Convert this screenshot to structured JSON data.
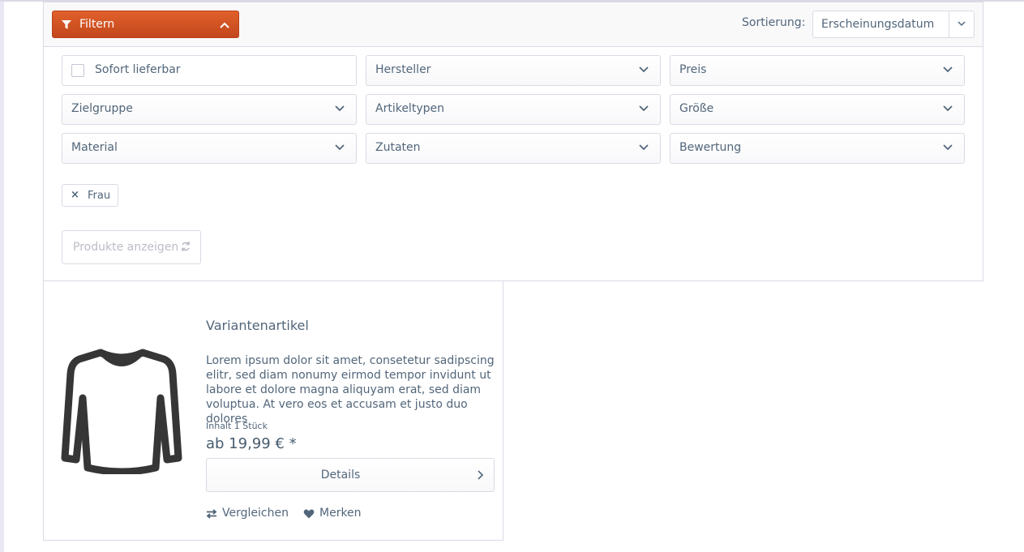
{
  "filter_panel": {
    "toggle_label": "Filtern",
    "sort_label": "Sortierung:",
    "sort_value": "Erscheinungsdatum",
    "facets": [
      {
        "label": "Sofort lieferbar",
        "kind": "checkbox",
        "checked": false
      },
      {
        "label": "Hersteller",
        "kind": "dropdown"
      },
      {
        "label": "Preis",
        "kind": "dropdown"
      },
      {
        "label": "Zielgruppe",
        "kind": "dropdown"
      },
      {
        "label": "Artikeltypen",
        "kind": "dropdown"
      },
      {
        "label": "Größe",
        "kind": "dropdown"
      },
      {
        "label": "Material",
        "kind": "dropdown"
      },
      {
        "label": "Zutaten",
        "kind": "dropdown"
      },
      {
        "label": "Bewertung",
        "kind": "dropdown"
      }
    ],
    "active_filters": [
      {
        "label": "Frau",
        "remove_glyph": "×"
      }
    ],
    "apply_button": "Produkte anzeigen"
  },
  "product": {
    "image_icon": "sweater-icon",
    "title": "Variantenartikel",
    "description": "Lorem ipsum dolor sit amet, consetetur sadipscing elitr, sed diam nonumy eirmod tempor invidunt ut labore et dolore magna aliquyam erat, sed diam voluptua. At vero eos et accusam et justo duo dolores",
    "unit": "Inhalt 1 Stück",
    "price": "ab 19,99 € *",
    "details_button": "Details",
    "compare_label": "Vergleichen",
    "wishlist_label": "Merken"
  },
  "colors": {
    "accent": "#d5521f",
    "text": "#52667a",
    "border": "#dadae5"
  }
}
